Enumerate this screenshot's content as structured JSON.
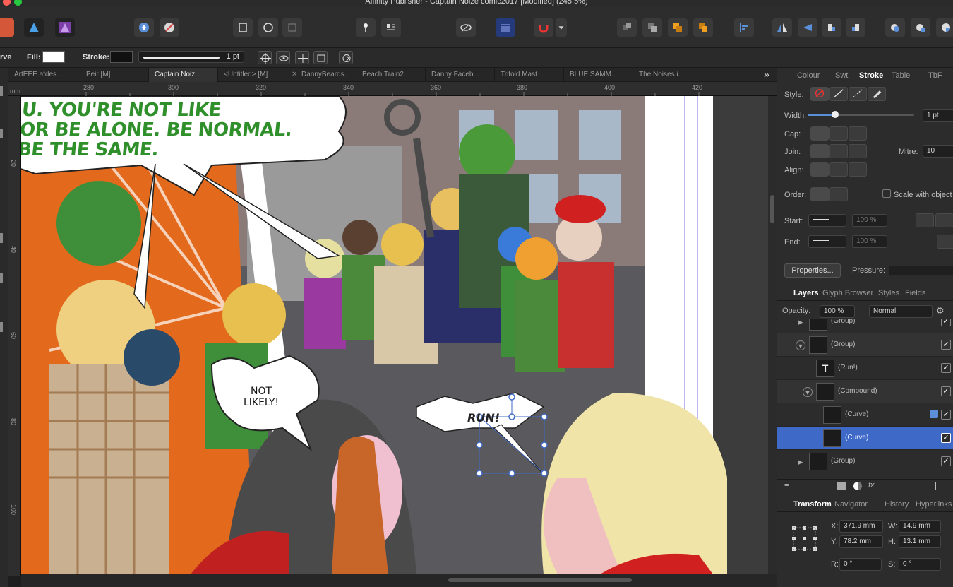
{
  "window": {
    "title": "Affinity Publisher - Captain Noize comic2017 [Modified] (245.5%)"
  },
  "context_bar": {
    "mode_label": "rve",
    "fill_label": "Fill:",
    "stroke_label": "Stroke:",
    "stroke_width": "1 pt",
    "fill_color": "#ffffff",
    "stroke_color": "#111111"
  },
  "doc_tabs": [
    "ArtEEE.afdes...",
    "Peir [M]",
    "Captain Noiz...",
    "<Untitled> [M]",
    "DannyBeards...",
    "Beach Train2...",
    "Danny Faceb...",
    "Trifold Mast",
    "BLUE SAMM...",
    "The Noises i..."
  ],
  "doc_tab_overflow": "»",
  "rulers": {
    "h_labels": [
      "280",
      "300",
      "320",
      "340",
      "360",
      "380",
      "400",
      "420"
    ],
    "v_labels": [
      "20",
      "40",
      "60",
      "80",
      "100"
    ],
    "unit": "mm"
  },
  "comic": {
    "speech_top": [
      "U. YOU'RE NOT LIKE",
      "OR BE ALONE. BE NORMAL.",
      "BE THE SAME."
    ],
    "speech_mid": [
      "NOT",
      "LIKELY!"
    ],
    "speech_run": "RUN!"
  },
  "stroke_panel": {
    "tabs": [
      "Colour",
      "Swt",
      "Stroke",
      "Table",
      "TbF"
    ],
    "active_tab": "Stroke",
    "style_label": "Style:",
    "width_label": "Width:",
    "width_value": "1 pt",
    "cap_label": "Cap:",
    "join_label": "Join:",
    "mitre_label": "Mitre:",
    "mitre_value": "10",
    "align_label": "Align:",
    "order_label": "Order:",
    "scale_label": "Scale with object",
    "start_label": "Start:",
    "end_label": "End:",
    "start_pct": "100 %",
    "end_pct": "100 %",
    "properties_label": "Properties...",
    "pressure_label": "Pressure:"
  },
  "layers_panel": {
    "tabs": [
      "Layers",
      "Glyph Browser",
      "Styles",
      "Fields"
    ],
    "active_tab": "Layers",
    "opacity_label": "Opacity:",
    "opacity_value": "100 %",
    "blend_mode": "Normal",
    "rows": [
      {
        "name": "(Group)",
        "indent": 0,
        "expanded": false,
        "selected": false
      },
      {
        "name": "(Group)",
        "indent": 0,
        "expanded": true,
        "selected": false
      },
      {
        "name": "(Run!)",
        "indent": 1,
        "expanded": null,
        "selected": false
      },
      {
        "name": "(Compound)",
        "indent": 1,
        "expanded": true,
        "selected": false
      },
      {
        "name": "(Curve)",
        "indent": 2,
        "expanded": null,
        "selected": false
      },
      {
        "name": "(Curve)",
        "indent": 2,
        "expanded": null,
        "selected": true
      },
      {
        "name": "(Group)",
        "indent": 0,
        "expanded": false,
        "selected": false
      }
    ]
  },
  "transform_panel": {
    "tabs": [
      "Transform",
      "Navigator",
      "History",
      "Hyperlinks"
    ],
    "active_tab": "Transform",
    "x_label": "X:",
    "x_value": "371.9 mm",
    "y_label": "Y:",
    "y_value": "78.2 mm",
    "w_label": "W:",
    "w_value": "14.9 mm",
    "h_label": "H:",
    "h_value": "13.1 mm",
    "r_label": "R:",
    "r_value": "0 °",
    "s_label": "S:",
    "s_value": "0 °"
  },
  "colors": {
    "accent": "#3f69c7",
    "speech_green": "#2f8f2a"
  }
}
